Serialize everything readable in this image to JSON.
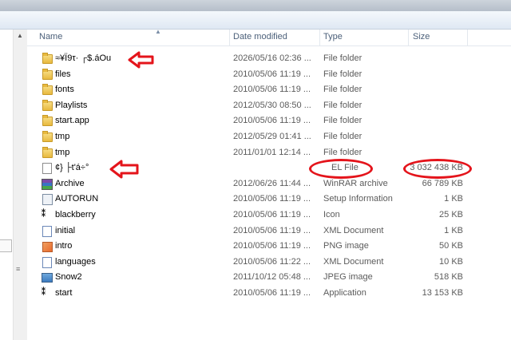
{
  "header": {
    "name": "Name",
    "date_modified": "Date modified",
    "type": "Type",
    "size": "Size"
  },
  "rows": [
    {
      "name": "≈¥Ï9τ· ┌$.áOu",
      "date": "2026/05/16 02:36 ...",
      "type": "File folder",
      "size": "",
      "icon": "folder-icon"
    },
    {
      "name": "files",
      "date": "2010/05/06 11:19 ...",
      "type": "File folder",
      "size": "",
      "icon": "folder-icon"
    },
    {
      "name": "fonts",
      "date": "2010/05/06 11:19 ...",
      "type": "File folder",
      "size": "",
      "icon": "folder-icon"
    },
    {
      "name": "Playlists",
      "date": "2012/05/30 08:50 ...",
      "type": "File folder",
      "size": "",
      "icon": "folder-icon"
    },
    {
      "name": "start.app",
      "date": "2010/05/06 11:19 ...",
      "type": "File folder",
      "size": "",
      "icon": "folder-icon"
    },
    {
      "name": "tmp",
      "date": "2012/05/29 01:41 ...",
      "type": "File folder",
      "size": "",
      "icon": "folder-icon"
    },
    {
      "name": "tmp",
      "date": "2011/01/01 12:14 ...",
      "type": "File folder",
      "size": "",
      "icon": "folder-icon"
    },
    {
      "name": "¢} ├t'á÷°",
      "date": "",
      "type": "EL File",
      "size": "3 032 438 KB",
      "icon": "file-icon"
    },
    {
      "name": "Archive",
      "date": "2012/06/26 11:44 ...",
      "type": "WinRAR archive",
      "size": "66 789 KB",
      "icon": "winrar-icon"
    },
    {
      "name": "AUTORUN",
      "date": "2010/05/06 11:19 ...",
      "type": "Setup Information",
      "size": "1 KB",
      "icon": "setup-info-icon"
    },
    {
      "name": "blackberry",
      "date": "2010/05/06 11:19 ...",
      "type": "Icon",
      "size": "25 KB",
      "icon": "blackberry-icon"
    },
    {
      "name": "initial",
      "date": "2010/05/06 11:19 ...",
      "type": "XML Document",
      "size": "1 KB",
      "icon": "xml-icon"
    },
    {
      "name": "intro",
      "date": "2010/05/06 11:19 ...",
      "type": "PNG image",
      "size": "50 KB",
      "icon": "png-icon"
    },
    {
      "name": "languages",
      "date": "2010/05/06 11:22 ...",
      "type": "XML Document",
      "size": "10 KB",
      "icon": "xml-icon"
    },
    {
      "name": "Snow2",
      "date": "2011/10/12 05:48 ...",
      "type": "JPEG image",
      "size": "518 KB",
      "icon": "jpeg-icon"
    },
    {
      "name": "start",
      "date": "2010/05/06 11:19 ...",
      "type": "Application",
      "size": "13 153 KB",
      "icon": "application-icon"
    }
  ],
  "colors": {
    "annotation": "#e4141b",
    "header_text": "#4c607a"
  }
}
